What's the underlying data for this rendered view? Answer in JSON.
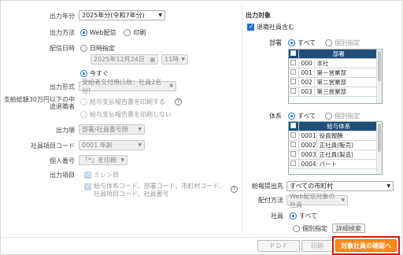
{
  "left": {
    "year_label": "出力年分",
    "year_value": "2025年分(令和7年分)",
    "method_label": "出力方法",
    "method_options": [
      "Web配信",
      "印刷"
    ],
    "date_label": "配信日時",
    "date_specify": "日時指定",
    "date_value": "2025年12月24日",
    "hour_value": "11時",
    "now_label": "今すぐ",
    "format_label": "出力形式",
    "format_value": "受給者交付用(1枚：社員2名分)",
    "exclude_label": "支給総額30万円以下の中途退職者",
    "exclude_options": [
      "給与支払報告書を印刷する",
      "給与支払報告書を印刷しない"
    ],
    "order_label": "出力順",
    "order_value": "部署/社員番号順",
    "emp_code_label": "社員項目コード",
    "emp_code_value": "0001 年齢",
    "mynumber_label": "個人番号",
    "mynumber_value": "「*」を印刷",
    "items_label": "出力項目",
    "items_options": [
      "ミシン目",
      "給与体系コード、部署コード、市町村コード、社員項目コード、社員番号"
    ]
  },
  "right": {
    "section_title": "出力対象",
    "retired_label": "退職社員含む",
    "dept_label": "部署",
    "dept_options": [
      "すべて",
      "個別指定"
    ],
    "dept_grid_header": "部署",
    "dept_rows": [
      {
        "code": "000",
        "name": "本社"
      },
      {
        "code": "001",
        "name": "第一営業部"
      },
      {
        "code": "002",
        "name": "第二営業部"
      },
      {
        "code": "003",
        "name": "第三営業部"
      }
    ],
    "system_label": "体系",
    "system_options": [
      "すべて",
      "個別指定"
    ],
    "system_grid_header": "給与体系",
    "system_rows": [
      {
        "code": "0001",
        "name": "役員報酬"
      },
      {
        "code": "0002",
        "name": "正社員(販売)"
      },
      {
        "code": "0003",
        "name": "正社員(製造)"
      },
      {
        "code": "0004",
        "name": "パート"
      }
    ],
    "submit_label": "給報提出先",
    "submit_value": "すべての市町村",
    "delivery_label": "配付方法",
    "delivery_value": "Web配信対象の社員",
    "employee_label": "社員",
    "employee_options": [
      "すべて",
      "個別指定"
    ],
    "detail_button": "詳細検索"
  },
  "footer": {
    "pdf": "ＰＤＦ",
    "print": "印刷",
    "confirm": "対象社員の確認へ"
  }
}
